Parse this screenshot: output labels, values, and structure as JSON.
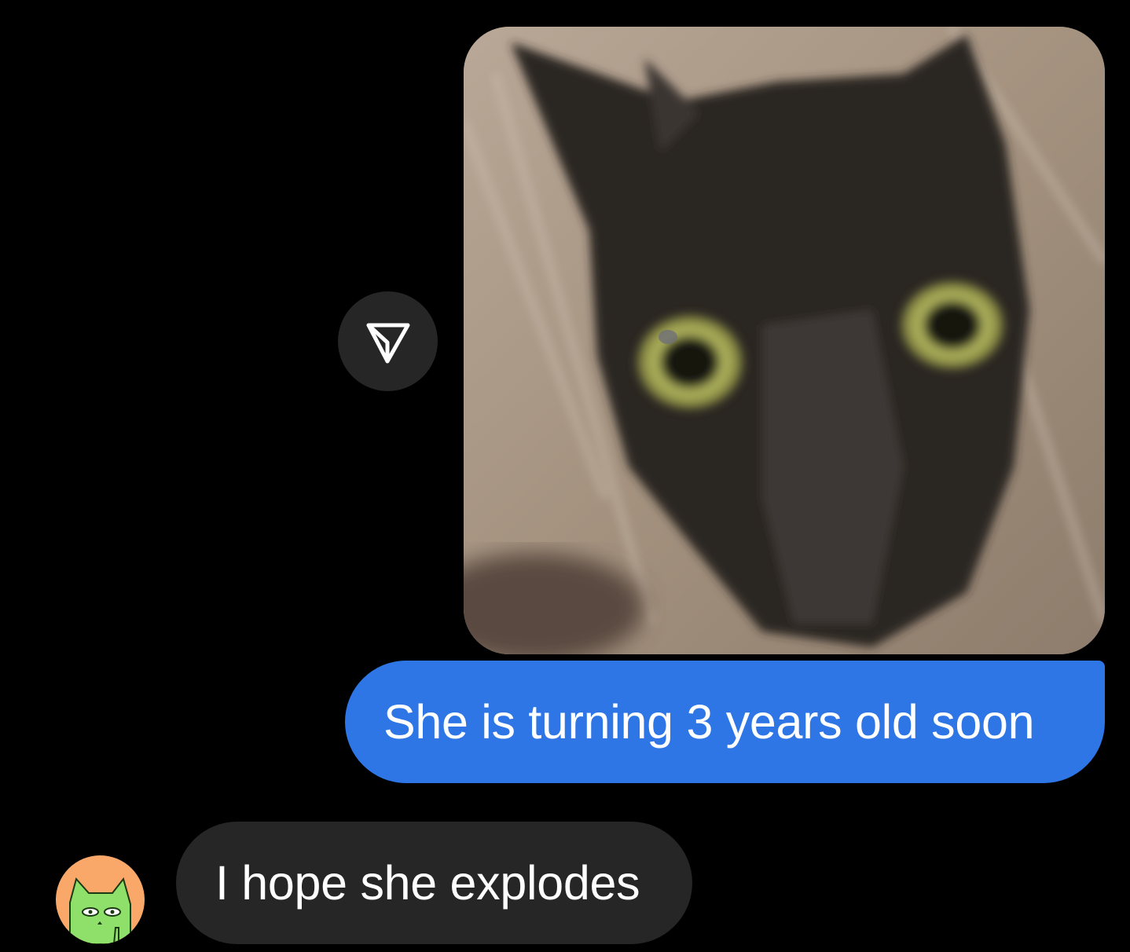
{
  "thread": {
    "messages": [
      {
        "direction": "outgoing",
        "type": "photo",
        "image_description_icon": "cat-photo"
      },
      {
        "direction": "outgoing",
        "type": "text",
        "text": "She is turning 3 years old soon"
      },
      {
        "direction": "incoming",
        "type": "text",
        "text": "I hope she explodes"
      }
    ],
    "share_icon": "paper-plane-icon",
    "avatar_icon": "green-cat-avatar"
  },
  "colors": {
    "background": "#000000",
    "outgoing_bubble": "#2e76e6",
    "incoming_bubble": "#262626",
    "share_button": "#262626",
    "avatar_bg": "#f9a86a",
    "avatar_cat": "#8fe06a"
  }
}
